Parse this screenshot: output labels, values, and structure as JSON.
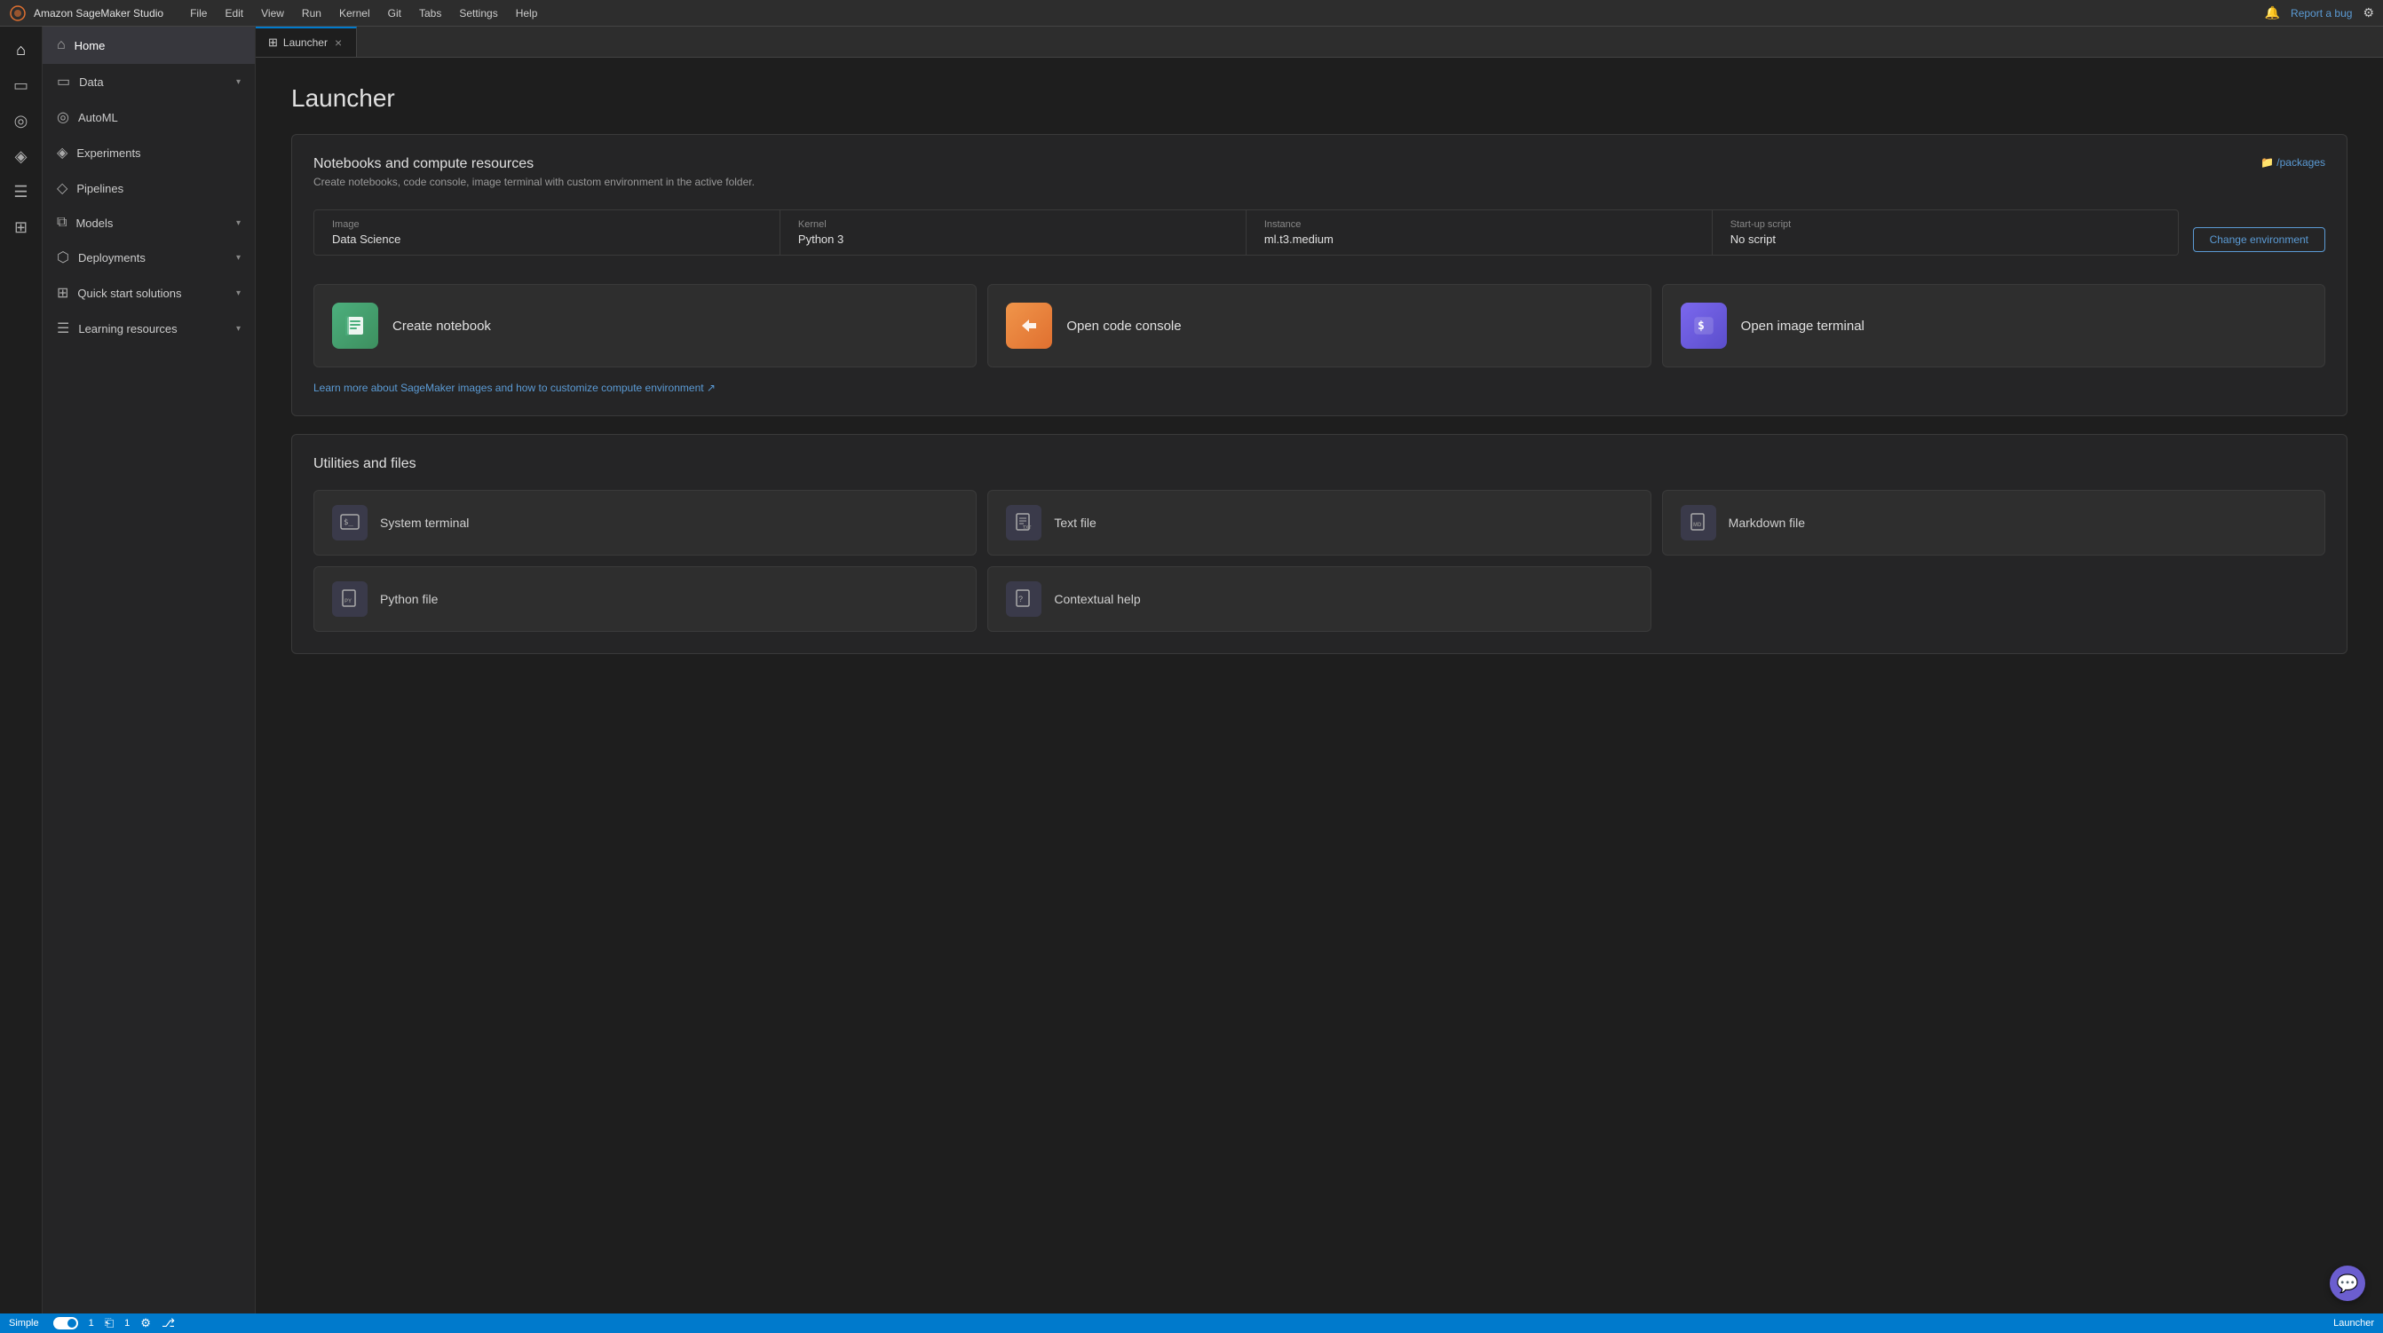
{
  "app": {
    "title": "Amazon SageMaker Studio",
    "report_bug": "Report a bug"
  },
  "menu": {
    "items": [
      "File",
      "Edit",
      "View",
      "Run",
      "Kernel",
      "Git",
      "Tabs",
      "Settings",
      "Help"
    ]
  },
  "sidebar": {
    "items": [
      {
        "id": "home",
        "label": "Home",
        "icon": "⌂",
        "hasChevron": false,
        "active": true
      },
      {
        "id": "data",
        "label": "Data",
        "icon": "▭",
        "hasChevron": true
      },
      {
        "id": "automl",
        "label": "AutoML",
        "icon": "◎",
        "hasChevron": false
      },
      {
        "id": "experiments",
        "label": "Experiments",
        "icon": "◈",
        "hasChevron": false
      },
      {
        "id": "pipelines",
        "label": "Pipelines",
        "icon": "◇",
        "hasChevron": false
      },
      {
        "id": "models",
        "label": "Models",
        "icon": "⧉",
        "hasChevron": true
      },
      {
        "id": "deployments",
        "label": "Deployments",
        "icon": "⬡",
        "hasChevron": true
      },
      {
        "id": "quick-start",
        "label": "Quick start solutions",
        "icon": "⊞",
        "hasChevron": true
      },
      {
        "id": "learning",
        "label": "Learning resources",
        "icon": "☰",
        "hasChevron": true
      }
    ]
  },
  "tab": {
    "icon": "⊞",
    "label": "Launcher",
    "close_label": "×"
  },
  "launcher": {
    "title": "Launcher",
    "notebooks_section": {
      "title": "Notebooks and compute resources",
      "description": "Create notebooks, code console, image terminal with custom environment in the active folder.",
      "packages_link": "📁 /packages",
      "environment": {
        "image_label": "Image",
        "image_value": "Data Science",
        "kernel_label": "Kernel",
        "kernel_value": "Python 3",
        "instance_label": "Instance",
        "instance_value": "ml.t3.medium",
        "script_label": "Start-up script",
        "script_value": "No script",
        "change_btn": "Change environment"
      },
      "actions": [
        {
          "id": "create-notebook",
          "label": "Create notebook",
          "icon": "🖼",
          "icon_class": "icon-green"
        },
        {
          "id": "open-code-console",
          "label": "Open code console",
          "icon": "▶",
          "icon_class": "icon-orange"
        },
        {
          "id": "open-image-terminal",
          "label": "Open image terminal",
          "icon": "$",
          "icon_class": "icon-purple"
        }
      ],
      "learn_link": "Learn more about SageMaker images and how to customize compute environment ↗"
    },
    "utilities_section": {
      "title": "Utilities and files",
      "items": [
        {
          "id": "system-terminal",
          "label": "System terminal",
          "icon": "⬜"
        },
        {
          "id": "text-file",
          "label": "Text file",
          "icon": "📄"
        },
        {
          "id": "markdown-file",
          "label": "Markdown file",
          "icon": "📝"
        },
        {
          "id": "python-file",
          "label": "Python file",
          "icon": "🐍"
        },
        {
          "id": "contextual-help",
          "label": "Contextual help",
          "icon": "📓"
        }
      ]
    }
  },
  "status_bar": {
    "mode": "Simple",
    "branch_icon": "⎇",
    "num1": "1",
    "num2": "1",
    "launcher_label": "Launcher"
  }
}
